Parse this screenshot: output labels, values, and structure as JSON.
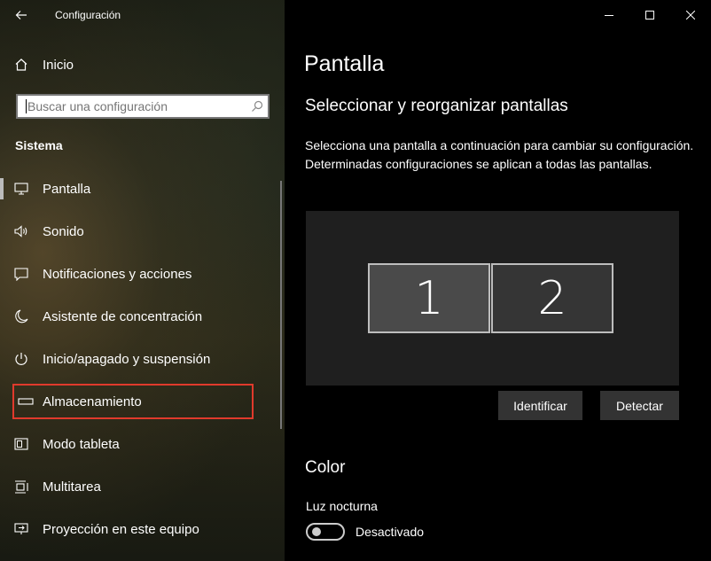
{
  "window": {
    "title": "Configuración"
  },
  "sidebar": {
    "home_label": "Inicio",
    "search_placeholder": "Buscar una configuración",
    "section_title": "Sistema",
    "items": [
      {
        "label": "Pantalla",
        "icon": "monitor-icon",
        "selected": true
      },
      {
        "label": "Sonido",
        "icon": "speaker-icon"
      },
      {
        "label": "Notificaciones y acciones",
        "icon": "notification-icon"
      },
      {
        "label": "Asistente de concentración",
        "icon": "moon-icon"
      },
      {
        "label": "Inicio/apagado y suspensión",
        "icon": "power-icon"
      },
      {
        "label": "Almacenamiento",
        "icon": "storage-icon",
        "highlighted": true
      },
      {
        "label": "Modo tableta",
        "icon": "tablet-icon"
      },
      {
        "label": "Multitarea",
        "icon": "multitask-icon"
      },
      {
        "label": "Proyección en este equipo",
        "icon": "projection-icon"
      }
    ]
  },
  "main": {
    "title": "Pantalla",
    "subheader": "Seleccionar y reorganizar pantallas",
    "description": "Selecciona una pantalla a continuación para cambiar su configuración. Determinadas configuraciones se aplican a todas las pantallas.",
    "monitors": [
      "1",
      "2"
    ],
    "identify_label": "Identificar",
    "detect_label": "Detectar",
    "color_header": "Color",
    "night_light_label": "Luz nocturna",
    "night_light_state": "Desactivado"
  },
  "colors": {
    "highlight_border": "#e03a2c",
    "content_background": "#000000",
    "display_area": "#1f1f1f",
    "button": "#333333"
  }
}
